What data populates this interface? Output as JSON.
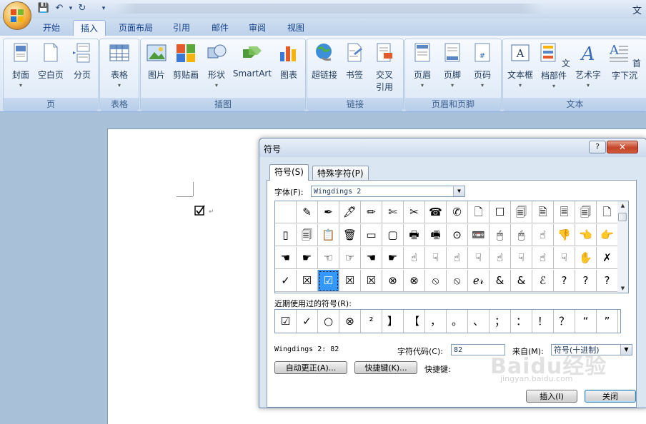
{
  "window": {
    "title": "文"
  },
  "quick_access": {
    "save": "💾",
    "undo": "↶",
    "redo": "↻",
    "more": "▾"
  },
  "tabs": [
    {
      "label": "开始"
    },
    {
      "label": "插入"
    },
    {
      "label": "页面布局"
    },
    {
      "label": "引用"
    },
    {
      "label": "邮件"
    },
    {
      "label": "审阅"
    },
    {
      "label": "视图"
    }
  ],
  "ribbon": {
    "groups": [
      {
        "label": "页",
        "buttons": [
          "封面",
          "空白页",
          "分页"
        ]
      },
      {
        "label": "表格",
        "buttons": [
          "表格"
        ]
      },
      {
        "label": "插图",
        "buttons": [
          "图片",
          "剪贴画",
          "形状",
          "SmartArt",
          "图表"
        ]
      },
      {
        "label": "链接",
        "buttons": [
          "超链接",
          "书签",
          "交叉",
          "引用"
        ]
      },
      {
        "label": "页眉和页脚",
        "buttons": [
          "页眉",
          "页脚",
          "页码"
        ]
      },
      {
        "label": "文本",
        "buttons": [
          "文本框",
          "文档部件",
          "艺术字",
          "首字下沉"
        ]
      }
    ]
  },
  "document": {
    "checkbox_symbol": "☑",
    "paragraph_mark": "↵"
  },
  "dialog": {
    "title": "符号",
    "help": "?",
    "close": "✕",
    "tabs": [
      "符号(S)",
      "特殊字符(P)"
    ],
    "font_label": "字体(F):",
    "font_value": "Wingdings 2",
    "symbol_rows": [
      [
        "",
        "✎",
        "✒",
        "🖋",
        "✏",
        "✄",
        "✂",
        "☎",
        "✆",
        "🗋",
        "☐",
        "🗐",
        "🗎",
        "🗏",
        "🗐",
        "🗋"
      ],
      [
        "▯",
        "🗐",
        "📋",
        "🗑",
        "▭",
        "▢",
        "🖶",
        "🖷",
        "⊙",
        "📼",
        "🖱",
        "🖱",
        "☝",
        "👎",
        "👈",
        "👉"
      ],
      [
        "☚",
        "☛",
        "☜",
        "☞",
        "☚",
        "☛",
        "☝",
        "☟",
        "☝",
        "☟",
        "☝",
        "☟",
        "☝",
        "☟",
        "✋",
        "✗"
      ],
      [
        "✓",
        "☒",
        "☑",
        "☒",
        "☒",
        "⊗",
        "⊗",
        "⦸",
        "⦸",
        "ℯ𝓇",
        "&",
        "&",
        "ℰ",
        "?",
        "?",
        "?"
      ]
    ],
    "selected": {
      "row": 3,
      "col": 2
    },
    "recent_label": "近期使用过的符号(R):",
    "recent_symbols": [
      "☑",
      "✓",
      "○",
      "⊗",
      "²",
      "】",
      "【",
      "，",
      "。",
      "、",
      "；",
      "：",
      "！",
      "？",
      "“",
      "”"
    ],
    "char_name": "Wingdings 2: 82",
    "code_label": "字符代码(C):",
    "code_value": "82",
    "from_label": "来自(M):",
    "from_value": "符号(十进制)",
    "autocorrect_button": "自动更正(A)...",
    "shortcut_button": "快捷键(K)...",
    "shortcut_label": "快捷键:",
    "insert_button": "插入(I)",
    "close_button": "关闭"
  },
  "watermark": {
    "main": "Baidu经验",
    "sub": "jingyan.baidu.com"
  },
  "colors": {
    "accent": "#3399ff",
    "ribbon_text": "#1e395b",
    "close_red": "#c4452a"
  }
}
